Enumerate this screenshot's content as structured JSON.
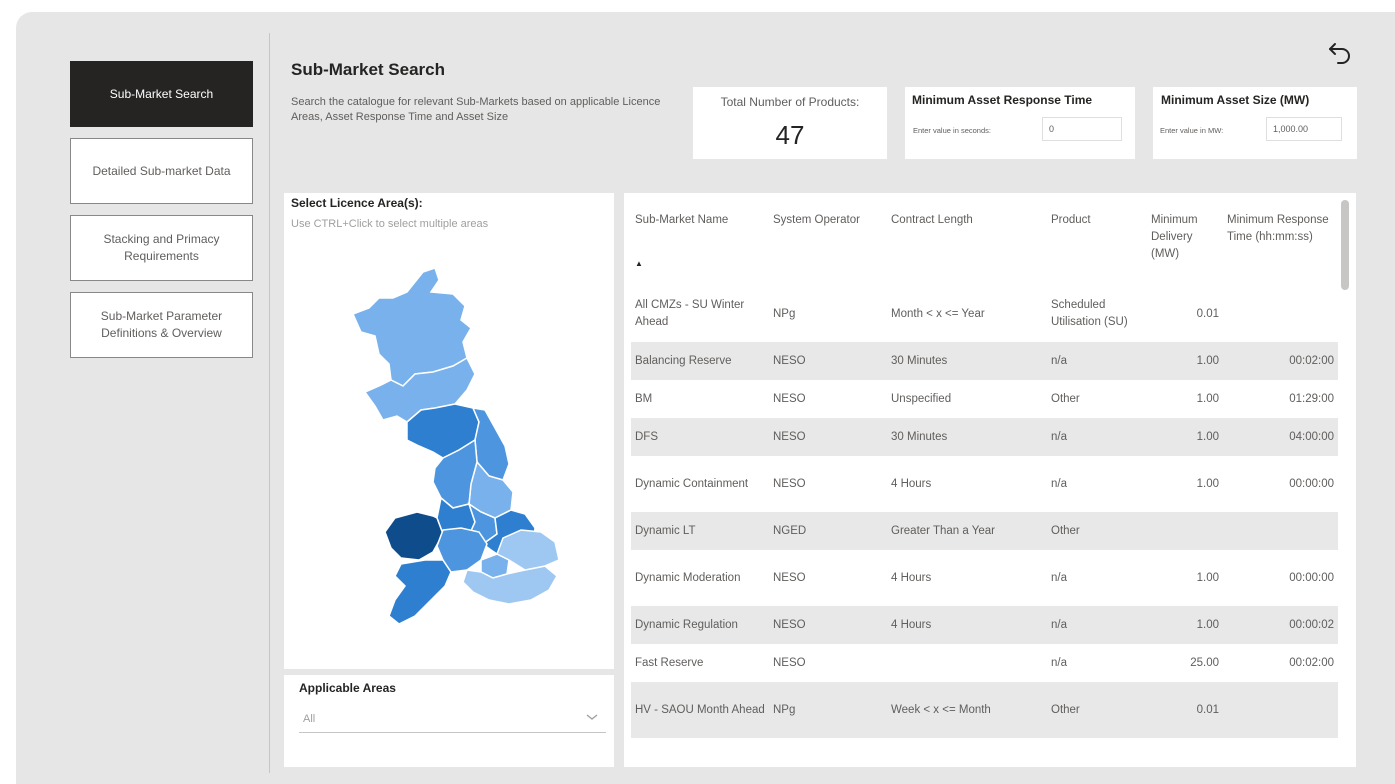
{
  "nav": {
    "items": [
      {
        "label": "Sub-Market Search"
      },
      {
        "label": "Detailed Sub-market Data"
      },
      {
        "label": "Stacking and Primacy Requirements"
      },
      {
        "label": "Sub-Market Parameter Definitions & Overview"
      }
    ]
  },
  "header": {
    "title": "Sub-Market Search",
    "subtitle": "Search the catalogue for relevant Sub-Markets based on applicable Licence Areas, Asset Response Time and Asset Size"
  },
  "kpi": {
    "label": "Total Number of Products:",
    "value": "47"
  },
  "filters": {
    "response_time": {
      "title": "Minimum Asset Response Time",
      "label": "Enter value in seconds:",
      "value": "0"
    },
    "asset_size": {
      "title": "Minimum Asset Size (MW)",
      "label": "Enter value in MW:",
      "value": "1,000.00"
    }
  },
  "map": {
    "title": "Select Licence Area(s):",
    "hint": "Use CTRL+Click to select multiple areas",
    "colors": {
      "darkest": "#0f4c8c",
      "dark": "#2e7fd0",
      "mid": "#4d96df",
      "light": "#78b1eb",
      "lighter": "#9ec8f2"
    }
  },
  "areas": {
    "title": "Applicable Areas",
    "value": "All"
  },
  "table": {
    "columns": [
      "Sub-Market Name",
      "System Operator",
      "Contract Length",
      "Product",
      "Minimum Delivery (MW)",
      "Minimum Response Time (hh:mm:ss)"
    ],
    "sort_indicator": "▲",
    "rows": [
      [
        "All CMZs - SU Winter Ahead",
        "NPg",
        "Month < x <= Year",
        "Scheduled Utilisation (SU)",
        "0.01",
        ""
      ],
      [
        "Balancing Reserve",
        "NESO",
        "30 Minutes",
        "n/a",
        "1.00",
        "00:02:00"
      ],
      [
        "BM",
        "NESO",
        "Unspecified",
        "Other",
        "1.00",
        "01:29:00"
      ],
      [
        "DFS",
        "NESO",
        "30 Minutes",
        "n/a",
        "1.00",
        "04:00:00"
      ],
      [
        "Dynamic Containment",
        "NESO",
        "4 Hours",
        "n/a",
        "1.00",
        "00:00:00"
      ],
      [
        "Dynamic LT",
        "NGED",
        "Greater Than a Year",
        "Other",
        "",
        ""
      ],
      [
        "Dynamic Moderation",
        "NESO",
        "4 Hours",
        "n/a",
        "1.00",
        "00:00:00"
      ],
      [
        "Dynamic Regulation",
        "NESO",
        "4 Hours",
        "n/a",
        "1.00",
        "00:00:02"
      ],
      [
        "Fast Reserve",
        "NESO",
        "",
        "n/a",
        "25.00",
        "00:02:00"
      ],
      [
        "HV - SAOU Month Ahead",
        "NPg",
        "Week < x <= Month",
        "Other",
        "0.01",
        ""
      ]
    ]
  }
}
